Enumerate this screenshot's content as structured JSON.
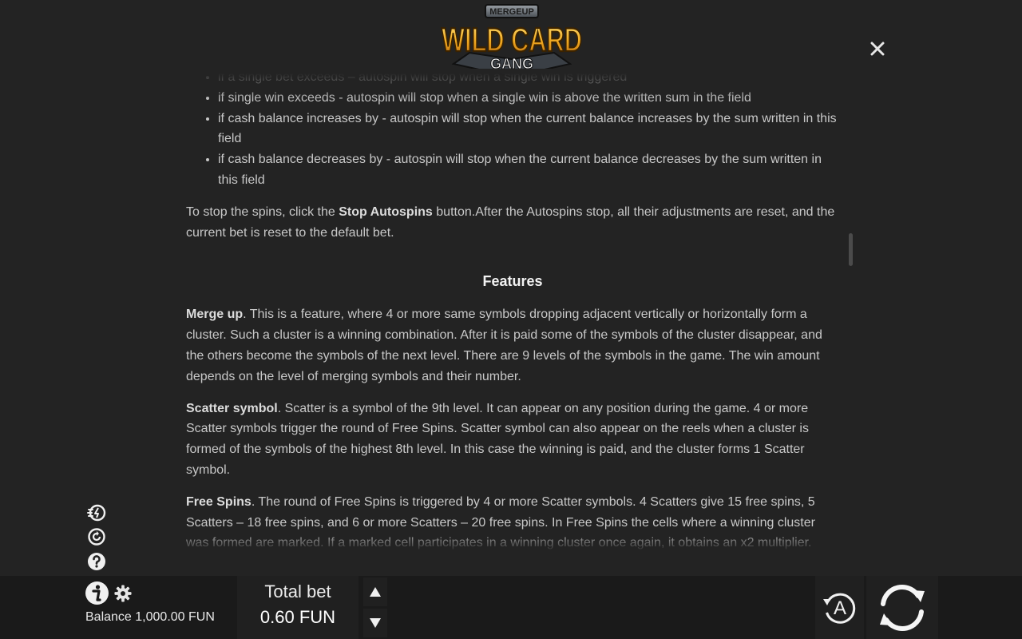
{
  "logo": {
    "top": "MERGEUP",
    "title": "WILD CARD",
    "subtitle": "GANG"
  },
  "rules": {
    "clipped_item": "if a single bet exceeds – autospin will stop when a single win is triggered",
    "items": [
      "if single win exceeds - autospin will stop when a single win is above the written sum in the field",
      "if cash balance increases by - autospin will stop when the current balance increases by the sum written in this field",
      "if cash balance decreases by - autospin will stop when the current balance decreases by the sum written in this field"
    ],
    "stop": {
      "before": "To stop the spins, click the ",
      "bold": "Stop Autospins",
      "after": " button.After the Autospins stop, all their adjustments are reset, and the current bet is reset to the default bet."
    },
    "features_heading": "Features",
    "features": [
      {
        "term": "Merge up",
        "text": ". This is a feature, where 4 or more same symbols dropping adjacent vertically or horizontally form a cluster. Such a cluster is a winning combination. After it is paid some of the symbols of the cluster disappear, and the others become the symbols of the next level. There are 9 levels of the symbols in the game. The win amount depends on the level of merging symbols and their number."
      },
      {
        "term": "Scatter symbol",
        "text": ". Scatter is a symbol of the 9th level. It can appear on any position during the game. 4 or more Scatter symbols trigger the round of Free Spins. Scatter symbol can also appear on the reels when a cluster is formed of the symbols of the highest 8th level. In this case the winning is paid, and the cluster forms 1 Scatter symbol."
      },
      {
        "term": "Free Spins",
        "text": ". The round of Free Spins is triggered by 4 or more Scatter symbols. 4 Scatters give 15 free spins, 5 Scatters – 18 free spins, and 6 or more Scatters – 20 free spins. In Free Spins the cells where a winning cluster was formed are marked. If a marked cell participates in a winning cluster once again, it obtains an x2 multiplier."
      }
    ]
  },
  "footer": {
    "balance_label": "Balance",
    "balance_value": "1,000.00 FUN",
    "bet_label": "Total bet",
    "bet_value": "0.60 FUN",
    "autospin_letter": "A"
  },
  "colors": {
    "background": "#232323",
    "bar": "#1a1a1a",
    "panel": "#202020",
    "text": "#c8c8c8"
  },
  "icons": [
    "close-icon",
    "turbo-icon",
    "quick-spin-icon",
    "help-icon",
    "info-icon",
    "gear-icon",
    "arrow-up-icon",
    "arrow-down-icon",
    "autospin-icon",
    "spin-icon"
  ]
}
